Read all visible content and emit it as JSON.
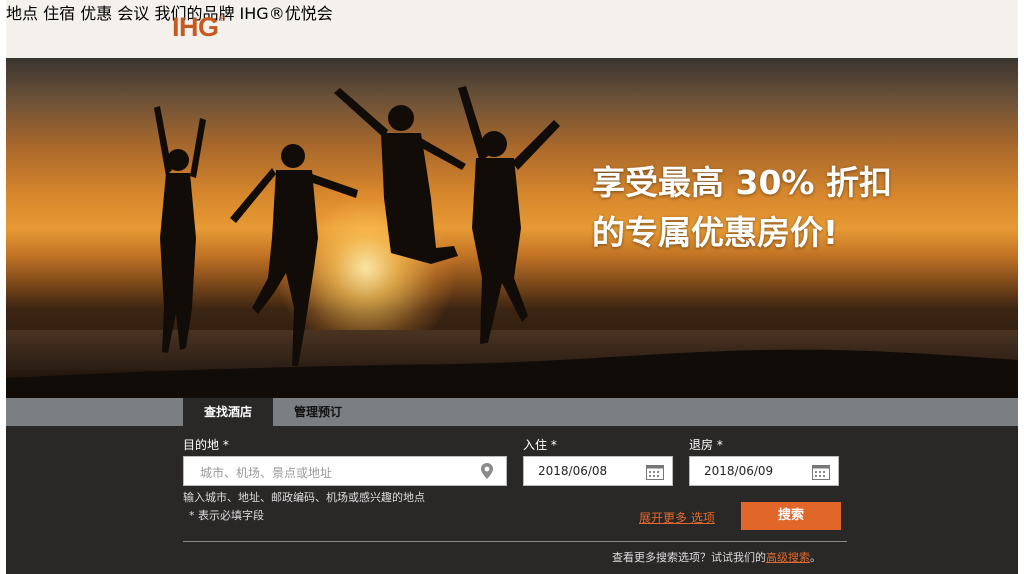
{
  "header": {
    "logo": "IHG",
    "logo_mark": "®",
    "nav": [
      "地点",
      "住宿",
      "优惠",
      "会议",
      "我们的品牌",
      "IHG®优悦会"
    ]
  },
  "hero": {
    "line1": "享受最高 30% 折扣",
    "line2": "的专属优惠房价!"
  },
  "search": {
    "tabs": [
      "查找酒店",
      "管理预订"
    ],
    "destination_label": "目的地 *",
    "destination_placeholder": "城市、机场、景点或地址",
    "destination_hint": "输入城市、地址、邮政编码、机场或感兴趣的地点",
    "required_note": "* 表示必填字段",
    "checkin_label": "入住 *",
    "checkin_value": "2018/06/08",
    "checkout_label": "退房 *",
    "checkout_value": "2018/06/09",
    "more_options": "展开更多 选项",
    "search_button": "搜索",
    "advanced_prefix": "查看更多搜索选项？试试我们的",
    "advanced_link": "高级搜索",
    "advanced_suffix": "。"
  },
  "colors": {
    "brand": "#c7581e",
    "button": "#e0662a",
    "panel": "#2a2727",
    "tabs_bar": "#7b7f81"
  },
  "icons": [
    "location-pin-icon",
    "calendar-icon"
  ]
}
